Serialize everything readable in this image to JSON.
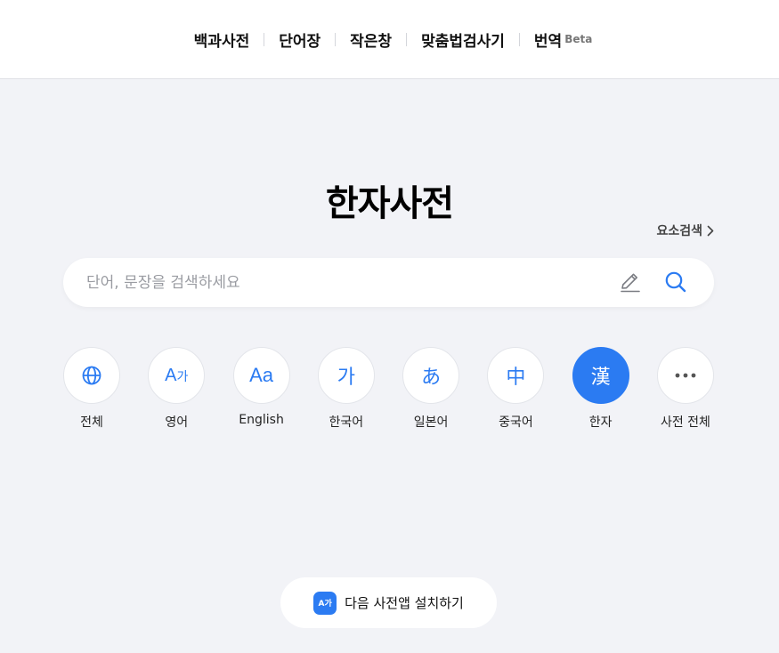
{
  "nav": {
    "items": [
      {
        "label": "백과사전"
      },
      {
        "label": "단어장"
      },
      {
        "label": "작은창"
      },
      {
        "label": "맞춤법검사기"
      },
      {
        "label": "번역",
        "badge": "Beta"
      }
    ]
  },
  "page": {
    "title": "한자사전",
    "element_search": "요소검색"
  },
  "search": {
    "placeholder": "단어, 문장을 검색하세요",
    "value": ""
  },
  "categories": [
    {
      "label": "전체",
      "icon": "globe-icon"
    },
    {
      "label": "영어",
      "icon": "A가"
    },
    {
      "label": "English",
      "icon": "Aa"
    },
    {
      "label": "한국어",
      "icon": "가"
    },
    {
      "label": "일본어",
      "icon": "あ"
    },
    {
      "label": "중국어",
      "icon": "中"
    },
    {
      "label": "한자",
      "icon": "漢",
      "active": true
    },
    {
      "label": "사전 전체",
      "icon": "more-icon"
    }
  ],
  "app_install": {
    "label": "다음 사전앱 설치하기",
    "icon_text": "A가"
  },
  "colors": {
    "accent": "#2b7bf2",
    "background": "#f2f3f7"
  }
}
